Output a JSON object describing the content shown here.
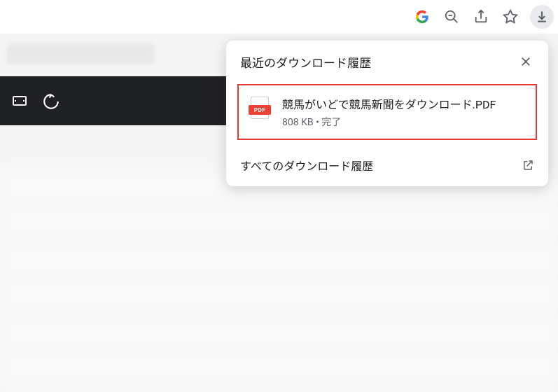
{
  "popup": {
    "title": "最近のダウンロード履歴",
    "item": {
      "filename": "競馬がいどで競馬新聞をダウンロード.PDF",
      "filesize": "808 KB",
      "status": "完了",
      "icon_label": "PDF"
    },
    "footer_text": "すべてのダウンロード履歴"
  }
}
